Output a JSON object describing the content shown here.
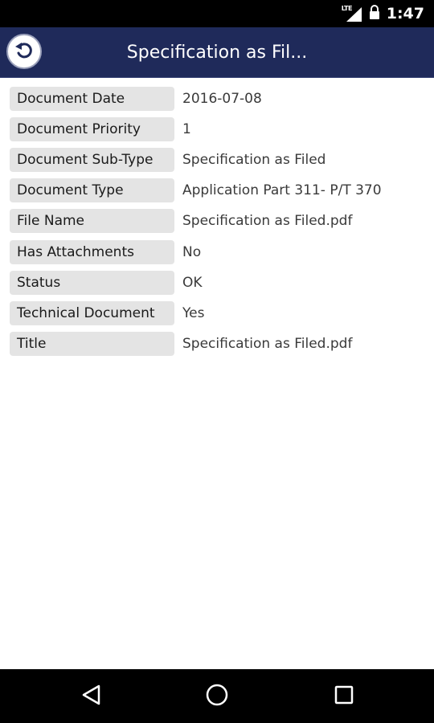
{
  "status_bar": {
    "network": "LTE",
    "time": "1:47"
  },
  "header": {
    "title": "Specification as Fil...",
    "back_icon": "back-arrow-circle-icon",
    "background": "#1f2a5a"
  },
  "properties": [
    {
      "label": "Document Date",
      "value": "2016-07-08"
    },
    {
      "label": "Document Priority",
      "value": "1"
    },
    {
      "label": "Document Sub-Type",
      "value": "Specification as Filed"
    },
    {
      "label": "Document Type",
      "value": "Application Part 311- P/T 370"
    },
    {
      "label": "File Name",
      "value": "Specification as Filed.pdf"
    },
    {
      "label": "Has Attachments",
      "value": "No"
    },
    {
      "label": "Status",
      "value": "OK"
    },
    {
      "label": "Technical Document",
      "value": "Yes"
    },
    {
      "label": "Title",
      "value": "Specification as Filed.pdf"
    }
  ],
  "nav": {
    "back": "back-triangle-icon",
    "home": "home-circle-icon",
    "recents": "recents-square-icon"
  }
}
